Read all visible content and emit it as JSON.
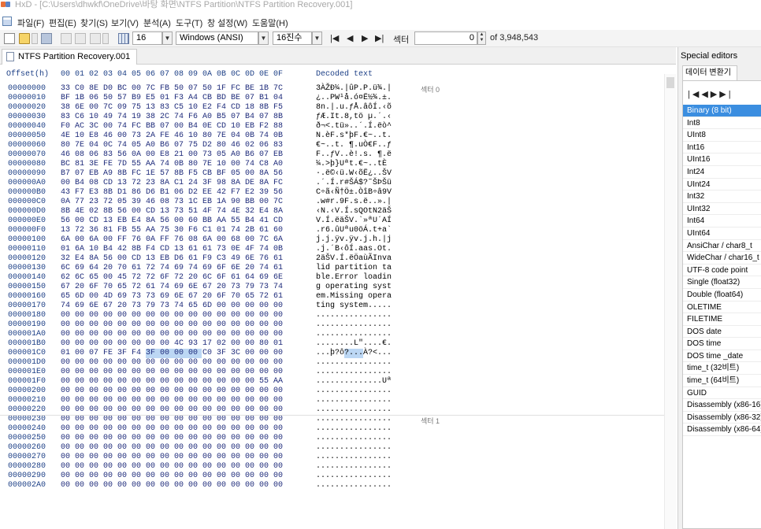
{
  "window": {
    "title": "HxD - [C:\\Users\\dhwkf\\OneDrive\\바탕 화면\\NTFS Partition\\NTFS Partition Recovery.001]"
  },
  "menu": [
    "파일(F)",
    "편집(E)",
    "찾기(S)",
    "보기(V)",
    "분석(A)",
    "도구(T)",
    "창 설정(W)",
    "도움말(H)"
  ],
  "toolbar": {
    "bytes_per_row": "16",
    "charset": "Windows (ANSI)",
    "offset_base": "16진수",
    "nav_glyphs": [
      "|◀",
      "◀",
      "▶",
      "▶|"
    ],
    "sector_label": "섹터",
    "sector_value": "0",
    "sector_total": "of 3,948,543"
  },
  "document": {
    "tab_label": "NTFS Partition Recovery.001",
    "header_offset": "Offset(h)",
    "header_cols": [
      "00",
      "01",
      "02",
      "03",
      "04",
      "05",
      "06",
      "07",
      "08",
      "09",
      "0A",
      "0B",
      "0C",
      "0D",
      "0E",
      "0F"
    ],
    "header_decoded": "Decoded text",
    "sector_labels": [
      "섹터 0",
      "섹터 1"
    ],
    "rows": [
      {
        "offset": "00000000",
        "hex": "33 C0 8E D0 BC 00 7C FB 50 07 50 1F FC BE 1B 7C",
        "text": "3ÀŽĐ¼.|ûP.P.ü¾.|"
      },
      {
        "offset": "00000010",
        "hex": "BF 1B 06 50 57 B9 E5 01 F3 A4 CB BD BE 07 B1 04",
        "text": "¿..PW¹å.ó¤Ë½¾.±."
      },
      {
        "offset": "00000020",
        "hex": "38 6E 00 7C 09 75 13 83 C5 10 E2 F4 CD 18 8B F5",
        "text": "8n.|.u.ƒÅ.âôÍ.‹õ"
      },
      {
        "offset": "00000030",
        "hex": "83 C6 10 49 74 19 38 2C 74 F6 A0 B5 07 B4 07 8B",
        "text": "ƒÆ.It.8,tö µ.´.‹"
      },
      {
        "offset": "00000040",
        "hex": "F0 AC 3C 00 74 FC BB 07 00 B4 0E CD 10 EB F2 88",
        "text": "ð¬<.tü»..´.Í.ëò^"
      },
      {
        "offset": "00000050",
        "hex": "4E 10 E8 46 00 73 2A FE 46 10 80 7E 04 0B 74 0B",
        "text": "N.èF.s*þF.€~..t."
      },
      {
        "offset": "00000060",
        "hex": "80 7E 04 0C 74 05 A0 B6 07 75 D2 80 46 02 06 83",
        "text": "€~..t. ¶.uÒ€F..ƒ"
      },
      {
        "offset": "00000070",
        "hex": "46 08 06 83 56 0A 00 E8 21 00 73 05 A0 B6 07 EB",
        "text": "F..ƒV..è!.s. ¶.ë"
      },
      {
        "offset": "00000080",
        "hex": "BC 81 3E FE 7D 55 AA 74 0B 80 7E 10 00 74 C8 A0",
        "text": "¼.>þ}Uªt.€~..tÈ "
      },
      {
        "offset": "00000090",
        "hex": "B7 07 EB A9 8B FC 1E 57 8B F5 CB BF 05 00 8A 56",
        "text": "·.ë©‹ü.W‹õË¿..ŠV"
      },
      {
        "offset": "000000A0",
        "hex": "00 B4 08 CD 13 72 23 8A C1 24 3F 98 8A DE 8A FC",
        "text": ".´.Í.r#ŠÁ$?˜ŠÞŠü"
      },
      {
        "offset": "000000B0",
        "hex": "43 F7 E3 8B D1 86 D6 B1 06 D2 EE 42 F7 E2 39 56",
        "text": "C÷ã‹Ñ†Ö±.ÒîB÷â9V"
      },
      {
        "offset": "000000C0",
        "hex": "0A 77 23 72 05 39 46 08 73 1C EB 1A 90 BB 00 7C",
        "text": ".w#r.9F.s.ë..».|"
      },
      {
        "offset": "000000D0",
        "hex": "8B 4E 02 8B 56 00 CD 13 73 51 4F 74 4E 32 E4 8A",
        "text": "‹N.‹V.Í.sQOtN2äŠ"
      },
      {
        "offset": "000000E0",
        "hex": "56 00 CD 13 EB E4 8A 56 00 60 BB AA 55 B4 41 CD",
        "text": "V.Í.ëäŠV.`»ªU´AÍ"
      },
      {
        "offset": "000000F0",
        "hex": "13 72 36 81 FB 55 AA 75 30 F6 C1 01 74 2B 61 60",
        "text": ".r6.ûUªu0öÁ.t+a`"
      },
      {
        "offset": "00000100",
        "hex": "6A 00 6A 00 FF 76 0A FF 76 08 6A 00 68 00 7C 6A",
        "text": "j.j.ÿv.ÿv.j.h.|j"
      },
      {
        "offset": "00000110",
        "hex": "01 6A 10 B4 42 8B F4 CD 13 61 61 73 0E 4F 74 0B",
        "text": ".j.´B‹ôÍ.aas.Ot."
      },
      {
        "offset": "00000120",
        "hex": "32 E4 8A 56 00 CD 13 EB D6 61 F9 C3 49 6E 76 61",
        "text": "2äŠV.Í.ëÖaùÃInva"
      },
      {
        "offset": "00000130",
        "hex": "6C 69 64 20 70 61 72 74 69 74 69 6F 6E 20 74 61",
        "text": "lid partition ta"
      },
      {
        "offset": "00000140",
        "hex": "62 6C 65 00 45 72 72 6F 72 20 6C 6F 61 64 69 6E",
        "text": "ble.Error loadin"
      },
      {
        "offset": "00000150",
        "hex": "67 20 6F 70 65 72 61 74 69 6E 67 20 73 79 73 74",
        "text": "g operating syst"
      },
      {
        "offset": "00000160",
        "hex": "65 6D 00 4D 69 73 73 69 6E 67 20 6F 70 65 72 61",
        "text": "em.Missing opera"
      },
      {
        "offset": "00000170",
        "hex": "74 69 6E 67 20 73 79 73 74 65 6D 00 00 00 00 00",
        "text": "ting system....."
      },
      {
        "offset": "00000180",
        "hex": "00 00 00 00 00 00 00 00 00 00 00 00 00 00 00 00",
        "text": "................"
      },
      {
        "offset": "00000190",
        "hex": "00 00 00 00 00 00 00 00 00 00 00 00 00 00 00 00",
        "text": "................"
      },
      {
        "offset": "000001A0",
        "hex": "00 00 00 00 00 00 00 00 00 00 00 00 00 00 00 00",
        "text": "................"
      },
      {
        "offset": "000001B0",
        "hex": "00 00 00 00 00 00 00 00 4C 93 17 02 00 00 80 01",
        "text": "........L\"....€."
      },
      {
        "offset": "000001C0",
        "hex": "01 00 07 FE 3F F4 3F 00 00 00 C0 3F 3C 00 00 00",
        "text": "...þ?ô?...À?<..."
      },
      {
        "offset": "000001D0",
        "hex": "00 00 00 00 00 00 00 00 00 00 00 00 00 00 00 00",
        "text": "................"
      },
      {
        "offset": "000001E0",
        "hex": "00 00 00 00 00 00 00 00 00 00 00 00 00 00 00 00",
        "text": "................"
      },
      {
        "offset": "000001F0",
        "hex": "00 00 00 00 00 00 00 00 00 00 00 00 00 00 55 AA",
        "text": "..............Uª"
      },
      {
        "offset": "00000200",
        "hex": "00 00 00 00 00 00 00 00 00 00 00 00 00 00 00 00",
        "text": "................"
      },
      {
        "offset": "00000210",
        "hex": "00 00 00 00 00 00 00 00 00 00 00 00 00 00 00 00",
        "text": "................"
      },
      {
        "offset": "00000220",
        "hex": "00 00 00 00 00 00 00 00 00 00 00 00 00 00 00 00",
        "text": "................"
      },
      {
        "offset": "00000230",
        "hex": "00 00 00 00 00 00 00 00 00 00 00 00 00 00 00 00",
        "text": "................"
      },
      {
        "offset": "00000240",
        "hex": "00 00 00 00 00 00 00 00 00 00 00 00 00 00 00 00",
        "text": "................"
      },
      {
        "offset": "00000250",
        "hex": "00 00 00 00 00 00 00 00 00 00 00 00 00 00 00 00",
        "text": "................"
      },
      {
        "offset": "00000260",
        "hex": "00 00 00 00 00 00 00 00 00 00 00 00 00 00 00 00",
        "text": "................"
      },
      {
        "offset": "00000270",
        "hex": "00 00 00 00 00 00 00 00 00 00 00 00 00 00 00 00",
        "text": "................"
      },
      {
        "offset": "00000280",
        "hex": "00 00 00 00 00 00 00 00 00 00 00 00 00 00 00 00",
        "text": "................"
      },
      {
        "offset": "00000290",
        "hex": "00 00 00 00 00 00 00 00 00 00 00 00 00 00 00 00",
        "text": "................"
      },
      {
        "offset": "000002A0",
        "hex": "00 00 00 00 00 00 00 00 00 00 00 00 00 00 00 00",
        "text": "................"
      }
    ]
  },
  "special_editors": {
    "title": "Special editors",
    "tab_label": "데이터 변환기",
    "nav_glyphs": "|◀◀▶▶|",
    "types": [
      "Binary (8 bit)",
      "Int8",
      "UInt8",
      "Int16",
      "UInt16",
      "Int24",
      "UInt24",
      "Int32",
      "UInt32",
      "Int64",
      "UInt64",
      "AnsiChar / char8_t",
      "WideChar / char16_t",
      "UTF-8 code point",
      "Single (float32)",
      "Double (float64)",
      "OLETIME",
      "FILETIME",
      "DOS date",
      "DOS time",
      "DOS time _date",
      "time_t (32비트)",
      "time_t (64비트)",
      "GUID",
      "Disassembly (x86-16)",
      "Disassembly (x86-32)",
      "Disassembly (x86-64)"
    ],
    "selected": "Binary (8 bit)"
  },
  "colors": {
    "offset_blue": "#1c3f86",
    "selection_light": "#bcd7f4",
    "selection_dark": "#3b8ee0"
  }
}
